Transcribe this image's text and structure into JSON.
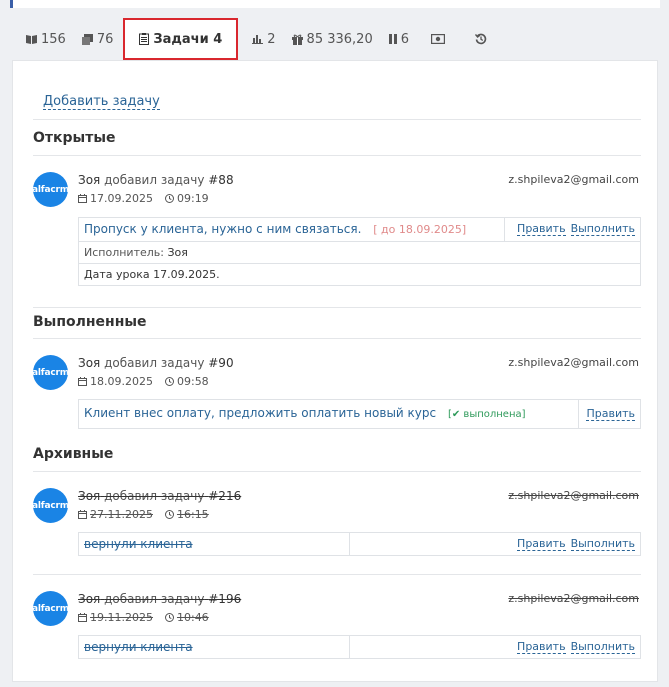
{
  "tabs": [
    {
      "icon": "book-icon",
      "label": "156"
    },
    {
      "icon": "notes-icon",
      "label": "76"
    },
    {
      "icon": "task-list-icon",
      "label": "Задачи 4",
      "active": true
    },
    {
      "icon": "bar-chart-icon",
      "label": "2"
    },
    {
      "icon": "gift-icon",
      "label": "85 336,20"
    },
    {
      "icon": "pause-icon",
      "label": "6"
    },
    {
      "icon": "cash-icon",
      "label": ""
    },
    {
      "icon": "history-icon",
      "label": ""
    }
  ],
  "add_task_label": "Добавить задачу",
  "avatar_text": "alfacrm",
  "sections": {
    "open": {
      "title": "Открытые"
    },
    "done": {
      "title": "Выполненные"
    },
    "archive": {
      "title": "Архивные"
    }
  },
  "tasks": [
    {
      "author": "Зоя",
      "verb": "добавил задачу",
      "number": "#88",
      "email": "z.shpileva2@gmail.com",
      "date": "17.09.2025",
      "time": "09:19",
      "text": "Пропуск у клиента, нужно с ним связаться.",
      "deadline": "[ до 18.09.2025]",
      "executor_label": "Исполнитель:",
      "executor": "Зоя",
      "note": "Дата урока 17.09.2025.",
      "edit_label": "Править",
      "complete_label": "Выполнить"
    },
    {
      "author": "Зоя",
      "verb": "добавил задачу",
      "number": "#90",
      "email": "z.shpileva2@gmail.com",
      "date": "18.09.2025",
      "time": "09:58",
      "text": "Клиент внес оплату, предложить оплатить новый курс",
      "status": "выполнена",
      "edit_label": "Править"
    },
    {
      "author": "Зоя",
      "verb": "добавил задачу",
      "number": "#216",
      "email": "z.shpileva2@gmail.com",
      "date": "27.11.2025",
      "time": "16:15",
      "text": "вернули клиента",
      "edit_label": "Править",
      "complete_label": "Выполнить"
    },
    {
      "author": "Зоя",
      "verb": "добавил задачу",
      "number": "#196",
      "email": "z.shpileva2@gmail.com",
      "date": "19.11.2025",
      "time": "10:46",
      "text": "вернули клиента",
      "edit_label": "Править",
      "complete_label": "Выполнить"
    }
  ],
  "colors": {
    "accent": "#2a6496",
    "active_tab_border": "#d9272e",
    "avatar": "#1a84e5",
    "deadline": "#e08a8a",
    "done": "#2e9a5a"
  }
}
